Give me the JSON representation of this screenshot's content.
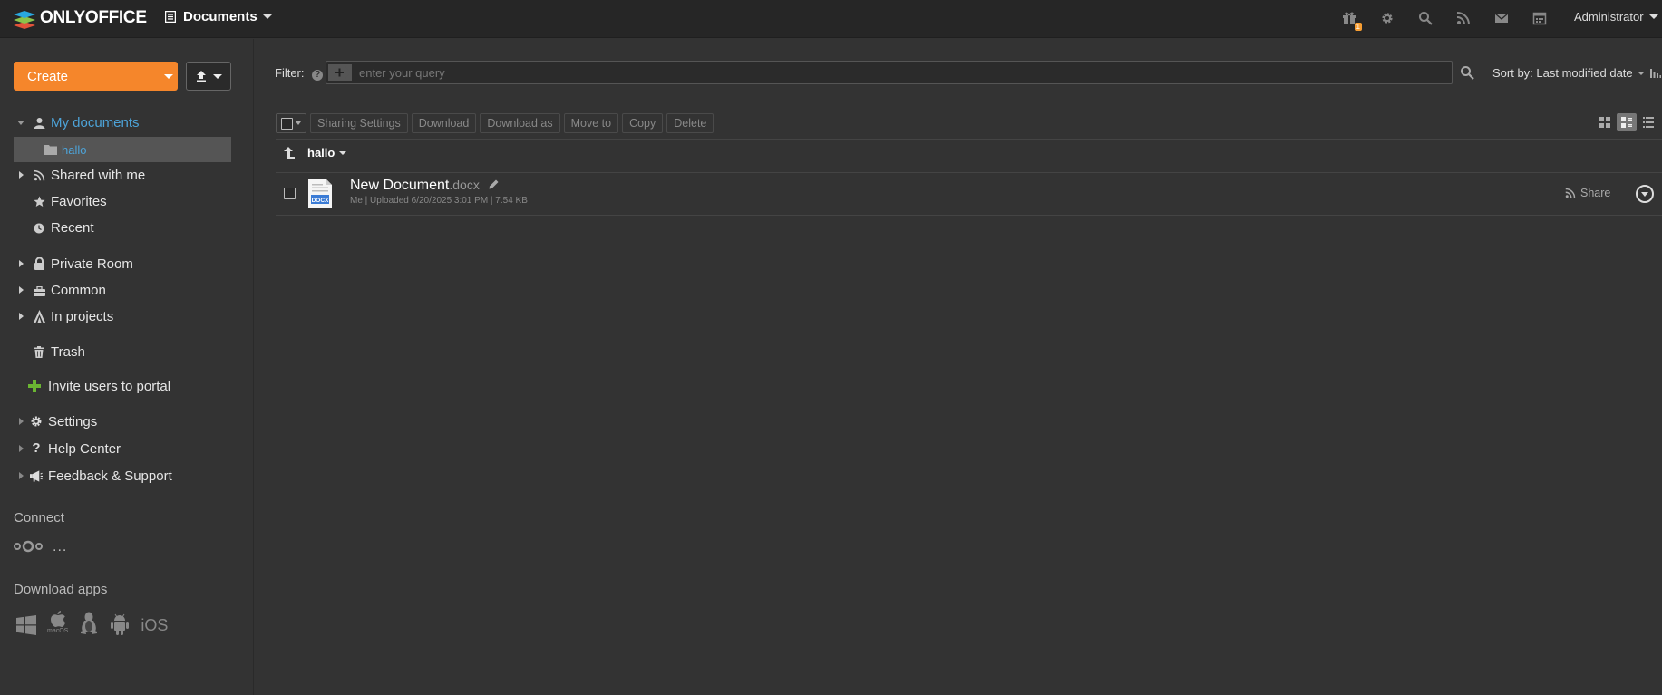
{
  "header": {
    "logo_text": "ONLYOFFICE",
    "module_label": "Documents",
    "icons": [
      "gift-icon",
      "gear-icon",
      "search-icon",
      "feed-icon",
      "mail-icon",
      "calendar-icon"
    ],
    "gift_badge": "1",
    "user_name": "Administrator"
  },
  "sidebar": {
    "create_label": "Create",
    "tree": {
      "my_documents": "My documents",
      "hallo": "hallo",
      "shared_with_me": "Shared with me",
      "favorites": "Favorites",
      "recent": "Recent",
      "private_room": "Private Room",
      "common": "Common",
      "in_projects": "In projects",
      "trash": "Trash"
    },
    "invite_label": "Invite users to portal",
    "settings_label": "Settings",
    "help_center_label": "Help Center",
    "feedback_label": "Feedback & Support",
    "connect_title": "Connect",
    "connect_more": "...",
    "download_apps_title": "Download apps",
    "apps": {
      "macos_caption": "macOS",
      "ios_label": "iOS"
    }
  },
  "filter": {
    "label": "Filter:",
    "help": "?",
    "placeholder": "enter your query",
    "sort_label": "Sort by: Last modified date"
  },
  "toolbar": {
    "sharing_settings": "Sharing Settings",
    "download": "Download",
    "download_as": "Download as",
    "move_to": "Move to",
    "copy": "Copy",
    "delete": "Delete"
  },
  "breadcrumb": {
    "folder": "hallo"
  },
  "files": [
    {
      "name": "New Document",
      "ext": ".docx",
      "meta": "Me | Uploaded 6/20/2025 3:01 PM | 7.54 KB",
      "share_label": "Share",
      "icon_label": "DOCX"
    }
  ],
  "colors": {
    "accent": "#f5862b",
    "link_blue": "#4da3d8",
    "background": "#333333",
    "topbar": "#262626"
  }
}
